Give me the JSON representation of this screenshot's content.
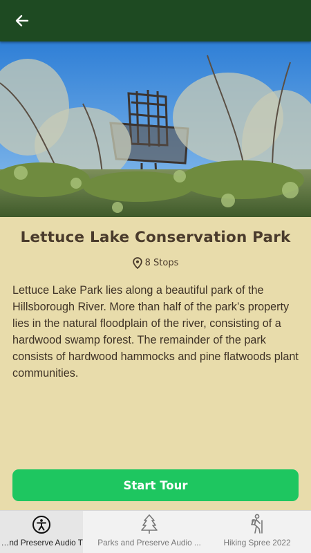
{
  "app_bar": {
    "back_icon": "arrow-left-icon",
    "bg_color": "#1e4a22"
  },
  "park": {
    "title": "Lettuce Lake Conservation Park",
    "stops_label": "8 Stops",
    "stops_icon": "map-pin-icon",
    "description": "Lettuce Lake Park lies along a beautiful park of the Hillsborough River. More than half of the park’s property lies in the natural floodplain of the river, consisting of a hardwood swamp forest. The remainder of the park consists of hardwood hammocks and pine flatwoods plant communities."
  },
  "start_button": {
    "label": "Start Tour",
    "color": "#1ec660"
  },
  "bottom_nav": [
    {
      "label": "Parks and Preserve Audio T...",
      "icon": "accessibility-icon",
      "active": true
    },
    {
      "label": "Parks and Preserve Audio ...",
      "icon": "pine-tree-icon",
      "active": false
    },
    {
      "label": "Hiking Spree 2022",
      "icon": "hiker-icon",
      "active": false
    }
  ]
}
